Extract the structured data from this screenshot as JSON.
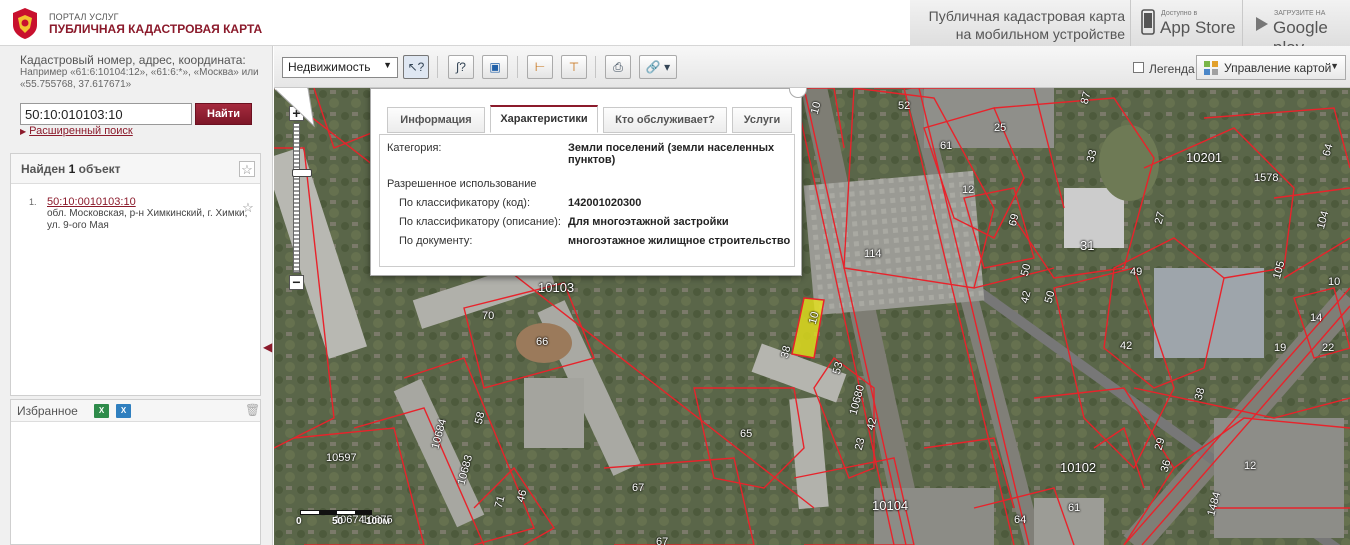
{
  "header": {
    "portal": "ПОРТАЛ УСЛУГ",
    "title": "ПУБЛИЧНАЯ КАДАСТРОВАЯ КАРТА",
    "mobile_text_line1": "Публичная кадастровая карта",
    "mobile_text_line2": "на мобильном устройстве",
    "appstore_small": "Доступно в",
    "appstore_big": "App Store",
    "googleplay_small": "ЗАГРУЗИТЕ НА",
    "googleplay_big": "Google play"
  },
  "search": {
    "title": "Кадастровый номер, адрес, координата:",
    "example": "Например «61:6:10104:12», «61:6:*», «Москва» или «55.755768, 37.617671»",
    "value": "50:10:010103:10",
    "find_label": "Найти",
    "advanced_label": "Расширенный поиск"
  },
  "results": {
    "found_prefix": "Найден",
    "found_count": "1",
    "found_suffix": "объект",
    "items": [
      {
        "num": "1.",
        "cad": "50:10:0010103:10",
        "address": "обл. Московская, р-н Химкинский, г. Химки, ул. 9-ого Мая"
      }
    ]
  },
  "favorites": {
    "title": "Избранное"
  },
  "toolbar": {
    "layer_select": "Недвижимость",
    "legend_label": "Легенда",
    "manage_label": "Управление картой"
  },
  "popup": {
    "tabs": [
      "Информация",
      "Характеристики",
      "Кто обслуживает?",
      "Услуги"
    ],
    "active_tab": "Характеристики",
    "category_label": "Категория:",
    "category_value": "Земли поселений (земли населенных пунктов)",
    "allowed_use": "Разрешенное использование",
    "rows": [
      {
        "label": "По классификатору (код):",
        "value": "142001020300"
      },
      {
        "label": "По классификатору (описание):",
        "value": "Для многоэтажной застройки"
      },
      {
        "label": "По документу:",
        "value": "многоэтажное жилищное строительство"
      }
    ]
  },
  "map": {
    "scale_labels": [
      "0",
      "50",
      "100м"
    ],
    "parcels": [
      "52",
      "25",
      "61",
      "12",
      "114",
      "69",
      "31",
      "50",
      "42",
      "50",
      "49",
      "27",
      "10201",
      "1578",
      "104",
      "105",
      "10",
      "14",
      "19",
      "22",
      "42",
      "10103",
      "70",
      "66",
      "38",
      "53",
      "10680",
      "42",
      "23",
      "65",
      "58",
      "10684",
      "10683",
      "10597",
      "46",
      "71",
      "67",
      "10104",
      "10102",
      "38",
      "29",
      "36",
      "12",
      "1484",
      "61",
      "64",
      "10675",
      "10674",
      "67",
      "10",
      "87",
      "33",
      "64",
      "10"
    ],
    "selected_parcel": "10"
  },
  "colors": {
    "brand": "#8b1a2b",
    "parcel_line": "#e8232b",
    "selected_fill": "#e6e21a"
  }
}
